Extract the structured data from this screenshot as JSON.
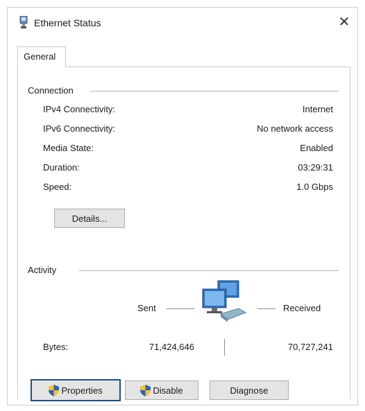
{
  "window": {
    "title": "Ethernet Status",
    "close_symbol": "✕"
  },
  "tabs": [
    {
      "label": "General"
    }
  ],
  "connection": {
    "heading": "Connection",
    "rows": [
      {
        "label": "IPv4 Connectivity:",
        "value": "Internet"
      },
      {
        "label": "IPv6 Connectivity:",
        "value": "No network access"
      },
      {
        "label": "Media State:",
        "value": "Enabled"
      },
      {
        "label": "Duration:",
        "value": "03:29:31"
      },
      {
        "label": "Speed:",
        "value": "1.0 Gbps"
      }
    ],
    "details_button": "Details..."
  },
  "activity": {
    "heading": "Activity",
    "sent_label": "Sent",
    "received_label": "Received",
    "bytes_label": "Bytes:",
    "bytes_sent": "71,424,646",
    "bytes_received": "70,727,241"
  },
  "buttons": {
    "properties": "Properties",
    "disable": "Disable",
    "diagnose": "Diagnose"
  },
  "icons": {
    "title": "ethernet-adapter-icon",
    "network": "network-computers-icon",
    "shield": "uac-shield-icon"
  },
  "colors": {
    "focus_border": "#1a4f8a",
    "button_face": "#e4e4e4"
  }
}
